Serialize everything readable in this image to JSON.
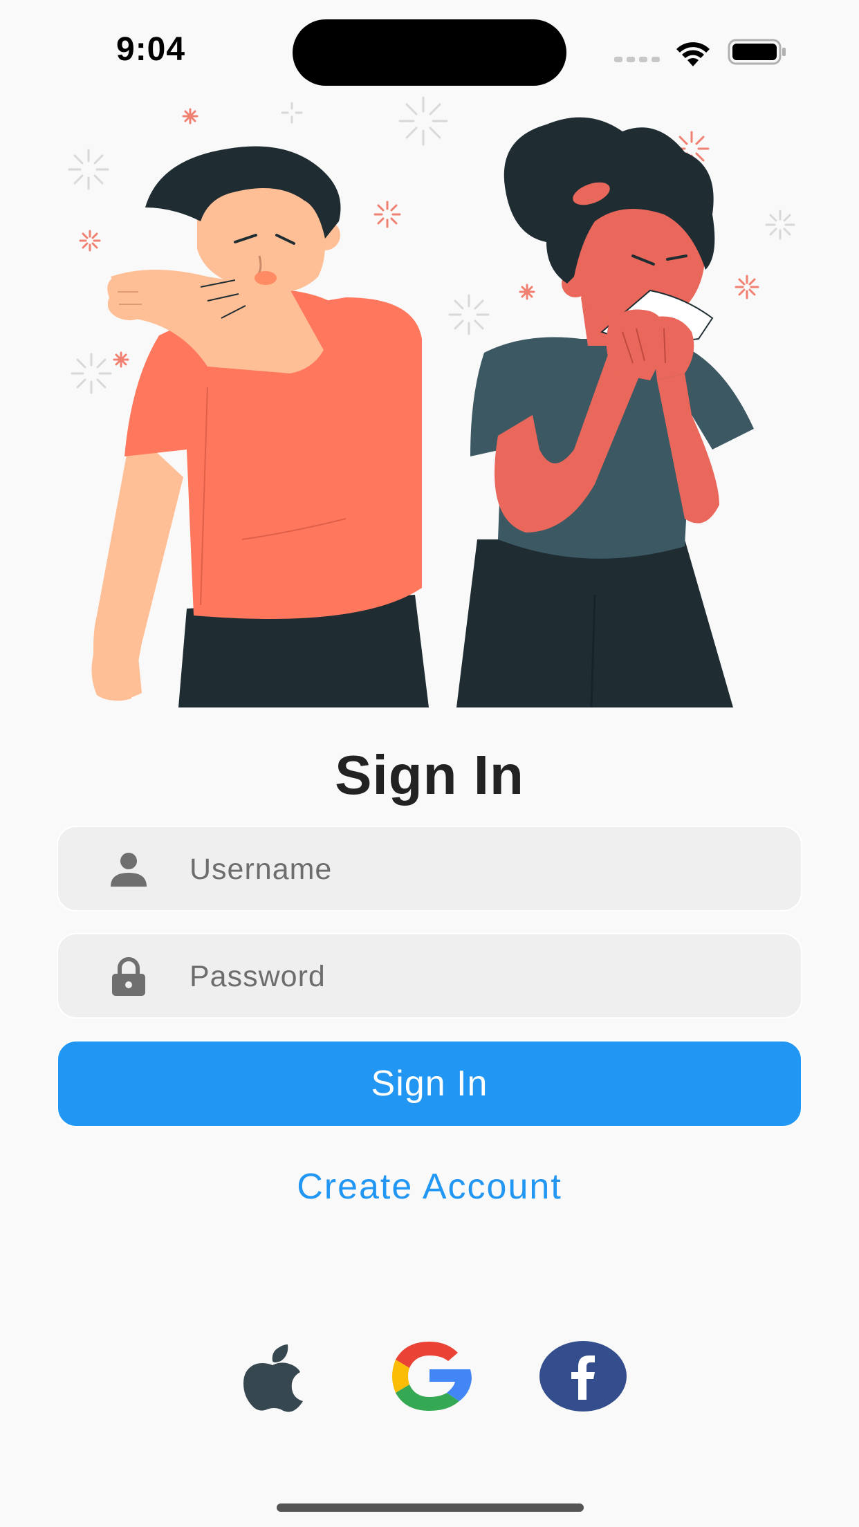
{
  "status_bar": {
    "time": "9:04"
  },
  "signin": {
    "title": "Sign In",
    "username_placeholder": "Username",
    "password_placeholder": "Password",
    "button_label": "Sign In",
    "create_account_label": "Create Account"
  },
  "icons": {
    "username": "person-icon",
    "password": "lock-icon",
    "social": [
      "apple-icon",
      "google-icon",
      "facebook-icon"
    ]
  },
  "colors": {
    "accent": "#2196f3",
    "field_bg": "#efefef",
    "title": "#222222",
    "facebook": "#344e8d",
    "apple": "#37474f"
  }
}
